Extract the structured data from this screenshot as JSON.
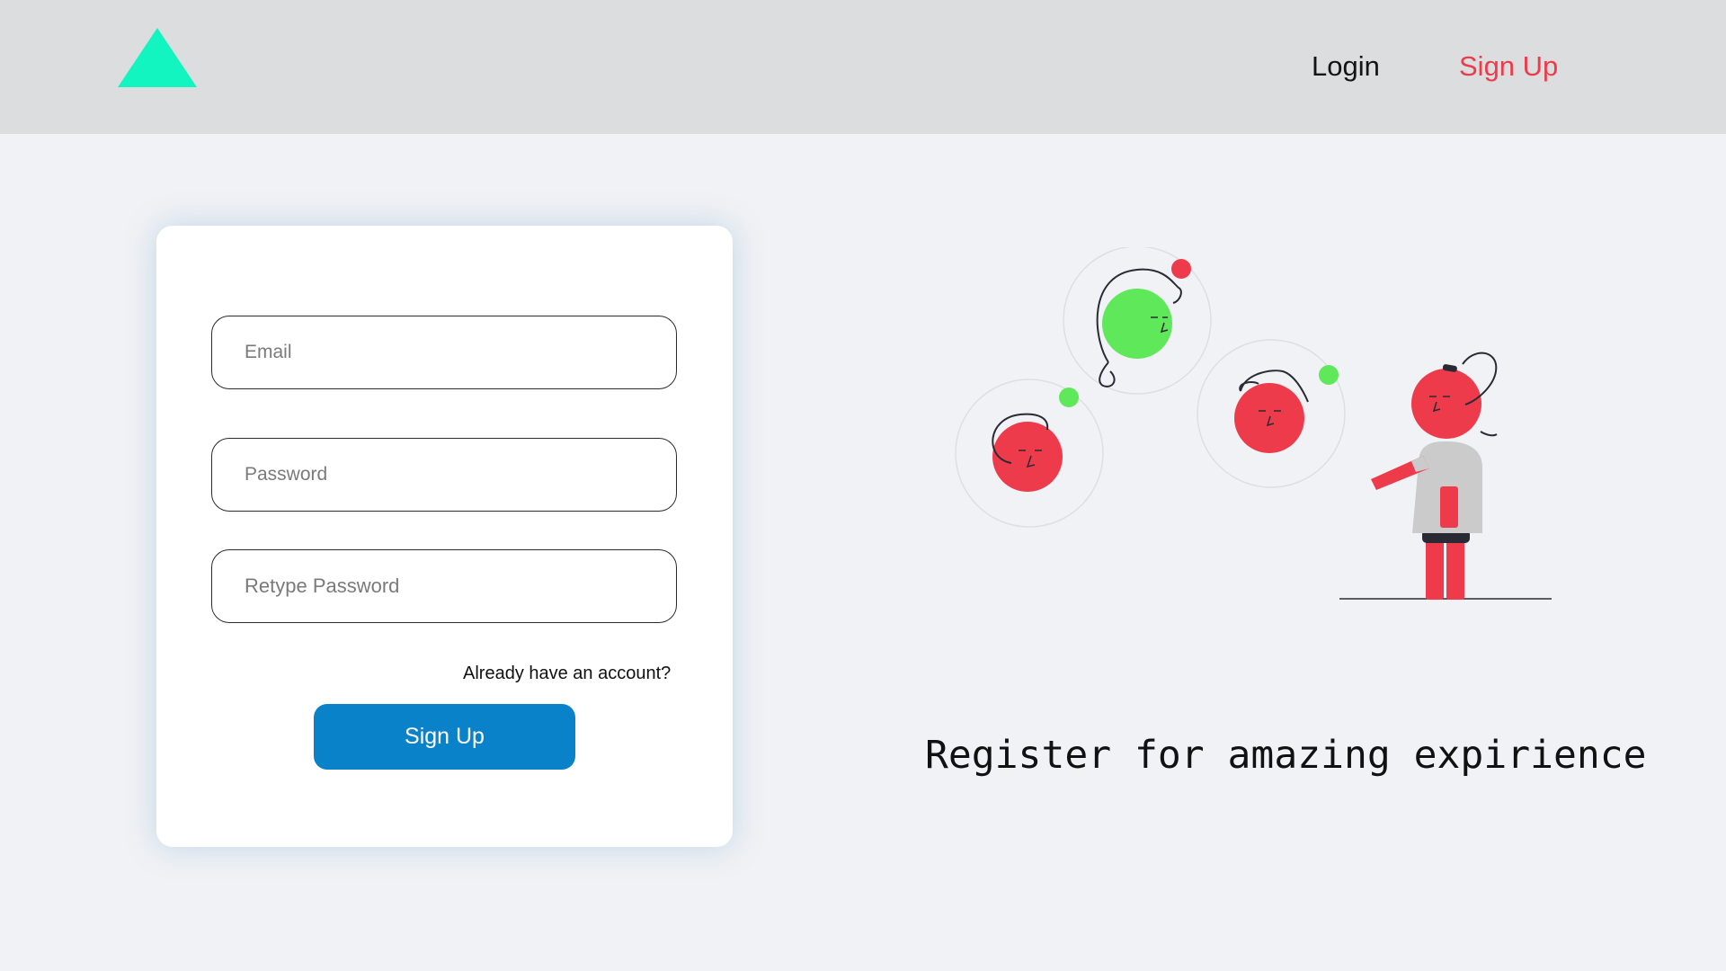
{
  "header": {
    "logo": {
      "icon": "triangle-logo-icon",
      "color": "#12f5c0"
    },
    "nav": {
      "login_label": "Login",
      "signup_label": "Sign Up",
      "signup_color": "#ee3b4b"
    }
  },
  "form": {
    "email": {
      "placeholder": "Email",
      "value": ""
    },
    "password": {
      "placeholder": "Password",
      "value": ""
    },
    "retype_password": {
      "placeholder": "Retype Password",
      "value": ""
    },
    "already_account_label": "Already have an account?",
    "submit_label": "Sign Up",
    "submit_color": "#0a82c9"
  },
  "hero": {
    "tagline": "Register for amazing expirience",
    "illustration": {
      "icon": "people-chat-illustration",
      "colors": {
        "red": "#ee3b4b",
        "green": "#5ee85a",
        "gray": "#cbcbcb",
        "dark": "#2a2a35"
      }
    }
  }
}
